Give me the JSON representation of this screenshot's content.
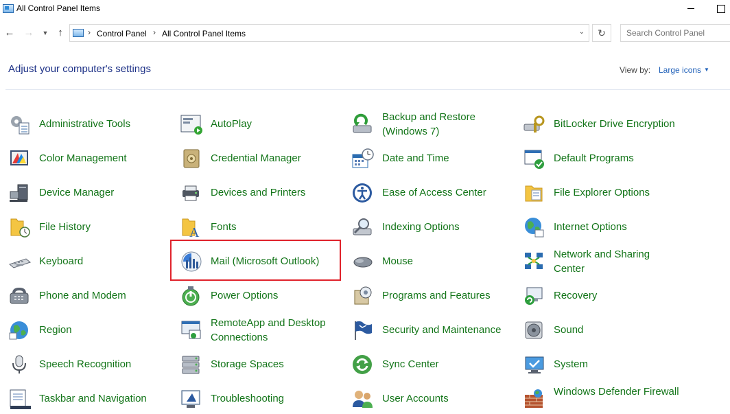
{
  "window": {
    "title": "All Control Panel Items"
  },
  "nav": {
    "back_icon": "arrow-left-icon",
    "forward_icon": "arrow-right-icon",
    "recent_icon": "chevron-down-icon",
    "up_icon": "arrow-up-icon",
    "breadcrumb": [
      "Control Panel",
      "All Control Panel Items"
    ],
    "refresh_icon": "refresh-icon",
    "search_placeholder": "Search Control Panel"
  },
  "header": {
    "title": "Adjust your computer's settings",
    "view_by_label": "View by:",
    "view_by_value": "Large icons"
  },
  "colors": {
    "title_blue": "#1e3287",
    "link_green": "#137519",
    "highlight_red": "#e0222b"
  },
  "items": [
    {
      "label": "Administrative Tools",
      "icon": "administrative-tools-icon"
    },
    {
      "label": "AutoPlay",
      "icon": "autoplay-icon"
    },
    {
      "label": "Backup and Restore (Windows 7)",
      "icon": "backup-restore-icon"
    },
    {
      "label": "BitLocker Drive Encryption",
      "icon": "bitlocker-icon"
    },
    {
      "label": "Color Management",
      "icon": "color-management-icon"
    },
    {
      "label": "Credential Manager",
      "icon": "credential-manager-icon"
    },
    {
      "label": "Date and Time",
      "icon": "date-time-icon"
    },
    {
      "label": "Default Programs",
      "icon": "default-programs-icon"
    },
    {
      "label": "Device Manager",
      "icon": "device-manager-icon"
    },
    {
      "label": "Devices and Printers",
      "icon": "devices-printers-icon"
    },
    {
      "label": "Ease of Access Center",
      "icon": "ease-of-access-icon"
    },
    {
      "label": "File Explorer Options",
      "icon": "file-explorer-options-icon"
    },
    {
      "label": "File History",
      "icon": "file-history-icon"
    },
    {
      "label": "Fonts",
      "icon": "fonts-icon"
    },
    {
      "label": "Indexing Options",
      "icon": "indexing-options-icon"
    },
    {
      "label": "Internet Options",
      "icon": "internet-options-icon"
    },
    {
      "label": "Keyboard",
      "icon": "keyboard-icon"
    },
    {
      "label": "Mail (Microsoft Outlook)",
      "icon": "mail-icon"
    },
    {
      "label": "Mouse",
      "icon": "mouse-icon"
    },
    {
      "label": "Network and Sharing Center",
      "icon": "network-sharing-icon"
    },
    {
      "label": "Phone and Modem",
      "icon": "phone-modem-icon"
    },
    {
      "label": "Power Options",
      "icon": "power-options-icon"
    },
    {
      "label": "Programs and Features",
      "icon": "programs-features-icon"
    },
    {
      "label": "Recovery",
      "icon": "recovery-icon"
    },
    {
      "label": "Region",
      "icon": "region-icon"
    },
    {
      "label": "RemoteApp and Desktop Connections",
      "icon": "remoteapp-icon"
    },
    {
      "label": "Security and Maintenance",
      "icon": "security-maintenance-icon"
    },
    {
      "label": "Sound",
      "icon": "sound-icon"
    },
    {
      "label": "Speech Recognition",
      "icon": "speech-recognition-icon"
    },
    {
      "label": "Storage Spaces",
      "icon": "storage-spaces-icon"
    },
    {
      "label": "Sync Center",
      "icon": "sync-center-icon"
    },
    {
      "label": "System",
      "icon": "system-icon"
    },
    {
      "label": "Taskbar and Navigation",
      "icon": "taskbar-navigation-icon"
    },
    {
      "label": "Troubleshooting",
      "icon": "troubleshooting-icon"
    },
    {
      "label": "User Accounts",
      "icon": "user-accounts-icon"
    },
    {
      "label": "Windows Defender Firewall",
      "icon": "firewall-icon"
    }
  ]
}
